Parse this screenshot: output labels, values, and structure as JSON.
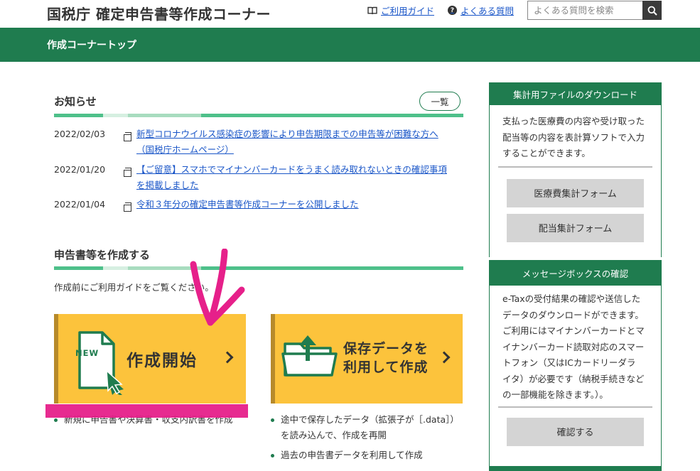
{
  "header": {
    "site_title": "国税庁 確定申告書等作成コーナー",
    "guide_link": "ご利用ガイド",
    "faq_link": "よくある質問",
    "search_placeholder": "よくある質問を検索"
  },
  "greenbar": {
    "breadcrumb": "作成コーナートップ"
  },
  "notices": {
    "title": "お知らせ",
    "more_label": "一覧",
    "items": [
      {
        "date": "2022/02/03",
        "lines": [
          "新型コロナウイルス感染症の影響により申告期限までの申告等が困難な方へ",
          "（国税庁ホームページ）"
        ]
      },
      {
        "date": "2022/01/20",
        "lines": [
          "【ご留意】スマホでマイナンバーカードをうまく読み取れないときの確認事項",
          "を掲載しました"
        ]
      },
      {
        "date": "2022/01/04",
        "lines": [
          "令和３年分の確定申告書等作成コーナーを公開しました"
        ]
      }
    ]
  },
  "create": {
    "title": "申告書等を作成する",
    "intro": "作成前にご利用ガイドをご覧ください。",
    "start_card": {
      "badge": "NEW",
      "label": "作成開始"
    },
    "resume_card": {
      "label_line1": "保存データを",
      "label_line2": "利用して作成"
    },
    "start_bullets": [
      "新規に申告書や決算書・収支内訳書を作成"
    ],
    "resume_bullets": [
      "途中で保存したデータ（拡張子が［.data］）",
      "を読み込んで、作成を再開",
      "過去の申告書データを利用して作成"
    ]
  },
  "sidebar": {
    "download": {
      "title": "集計用ファイルのダウンロード",
      "desc": [
        "支払った医療費の内容や受け取った",
        "配当等の内容を表計算ソフトで入力",
        "することができます。"
      ],
      "btn_medical": "医療費集計フォーム",
      "btn_dividend": "配当集計フォーム"
    },
    "messagebox": {
      "title": "メッセージボックスの確認",
      "desc": [
        "e-Taxの受付結果の確認や送信した",
        "データのダウンロードができます。",
        "ご利用にはマイナンバーカードとマ",
        "イナンバーカード読取対応のスマー",
        "トフォン（又はICカードリーダラ",
        "イタ）が必要です（納税手続きなど",
        "の一部機能を除きます。）。"
      ],
      "btn_confirm": "確認する"
    }
  },
  "colors": {
    "brand_green": "#1f7c4f",
    "card_yellow": "#fcc33c",
    "link_blue": "#1a56c8",
    "annotation_pink": "#e6208a"
  }
}
